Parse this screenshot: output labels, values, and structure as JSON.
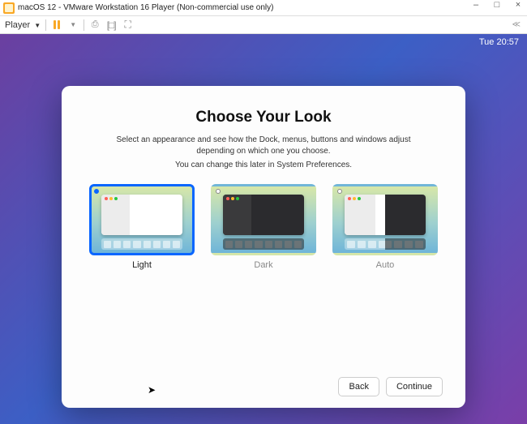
{
  "vmware": {
    "title": "macOS 12 - VMware Workstation 16 Player (Non-commercial use only)",
    "player_menu": "Player",
    "right_indicator": "≪"
  },
  "window_controls": {
    "min": "–",
    "max": "□",
    "close": "×"
  },
  "mac": {
    "clock": "Tue 20:57"
  },
  "setup": {
    "title": "Choose Your Look",
    "description": "Select an appearance and see how the Dock, menus, buttons and windows adjust depending on which one you choose.",
    "note": "You can change this later in System Preferences.",
    "options": {
      "light": "Light",
      "dark": "Dark",
      "auto": "Auto"
    },
    "buttons": {
      "back": "Back",
      "continue": "Continue"
    }
  }
}
